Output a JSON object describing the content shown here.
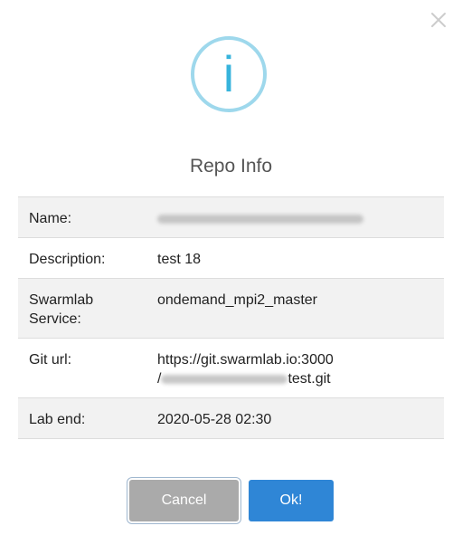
{
  "dialog": {
    "title": "Repo Info",
    "info_glyph": "i",
    "icons": {
      "close": "close-icon",
      "info": "info-icon"
    },
    "colors": {
      "info_ring": "#9ed8ec",
      "info_glyph": "#37b4dc",
      "ok_button": "#2f86d6",
      "cancel_button": "#aaaaaa"
    }
  },
  "rows": {
    "name": {
      "label": "Name:"
    },
    "description": {
      "label": "Description:",
      "value": "test 18"
    },
    "service": {
      "label_line1": "Swarmlab",
      "label_line2": "Service:",
      "value": "ondemand_mpi2_master"
    },
    "git_url": {
      "label": "Git url:",
      "value_line1": "https://git.swarmlab.io:3000",
      "value_prefix": "/",
      "value_suffix": "test.git"
    },
    "lab_end": {
      "label": "Lab end:",
      "value": "2020-05-28 02:30"
    }
  },
  "buttons": {
    "cancel_label": "Cancel",
    "ok_label": "Ok!"
  }
}
